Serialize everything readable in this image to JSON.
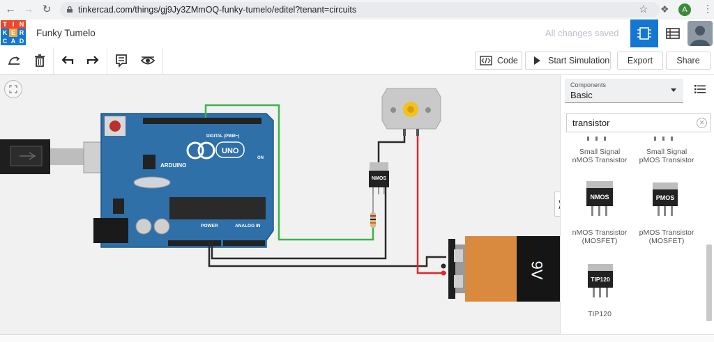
{
  "browser": {
    "url": "tinkercad.com/things/gj9Jy3ZMmOQ-funky-tumelo/editel?tenant=circuits",
    "profile_initial": "A"
  },
  "header": {
    "logo_letters": [
      "T",
      "I",
      "N",
      "K",
      "E",
      "R",
      "C",
      "A",
      "D"
    ],
    "logo_colors": [
      "#e9482b",
      "#e9482b",
      "#e9482b",
      "#1477d1",
      "#f4a63a",
      "#1477d1",
      "#1477d1",
      "#1477d1",
      "#1477d1"
    ],
    "title": "Funky Tumelo",
    "save_status": "All changes saved"
  },
  "toolbar": {
    "code_label": "Code",
    "simulate_label": "Start Simulation",
    "export_label": "Export",
    "share_label": "Share"
  },
  "canvas": {
    "motor_label": "",
    "mosfet_label": "NMOS",
    "battery_label": "9V",
    "arduino": {
      "brand": "ARDUINO",
      "model": "UNO",
      "digital_label": "DIGITAL (PWM~)",
      "power_label": "POWER",
      "analog_label": "ANALOG IN",
      "on_label": "ON"
    }
  },
  "panel": {
    "components_label": "Components",
    "components_value": "Basic",
    "search_value": "transistor",
    "items": [
      {
        "line1": "Small Signal",
        "line2": "nMOS Transistor"
      },
      {
        "line1": "Small Signal",
        "line2": "pMOS Transistor"
      },
      {
        "chip": "NMOS",
        "line1": "nMOS Transistor",
        "line2": "(MOSFET)"
      },
      {
        "chip": "PMOS",
        "line1": "pMOS Transistor",
        "line2": "(MOSFET)"
      },
      {
        "chip": "TIP120",
        "line1": "TIP120",
        "line2": ""
      }
    ]
  },
  "colors": {
    "accent": "#1477d1",
    "arduino_blue": "#2f70a8",
    "wire_green": "#3db34a",
    "wire_red": "#e3262b",
    "wire_black": "#2a2a2a",
    "battery_orange": "#d98a3f"
  }
}
